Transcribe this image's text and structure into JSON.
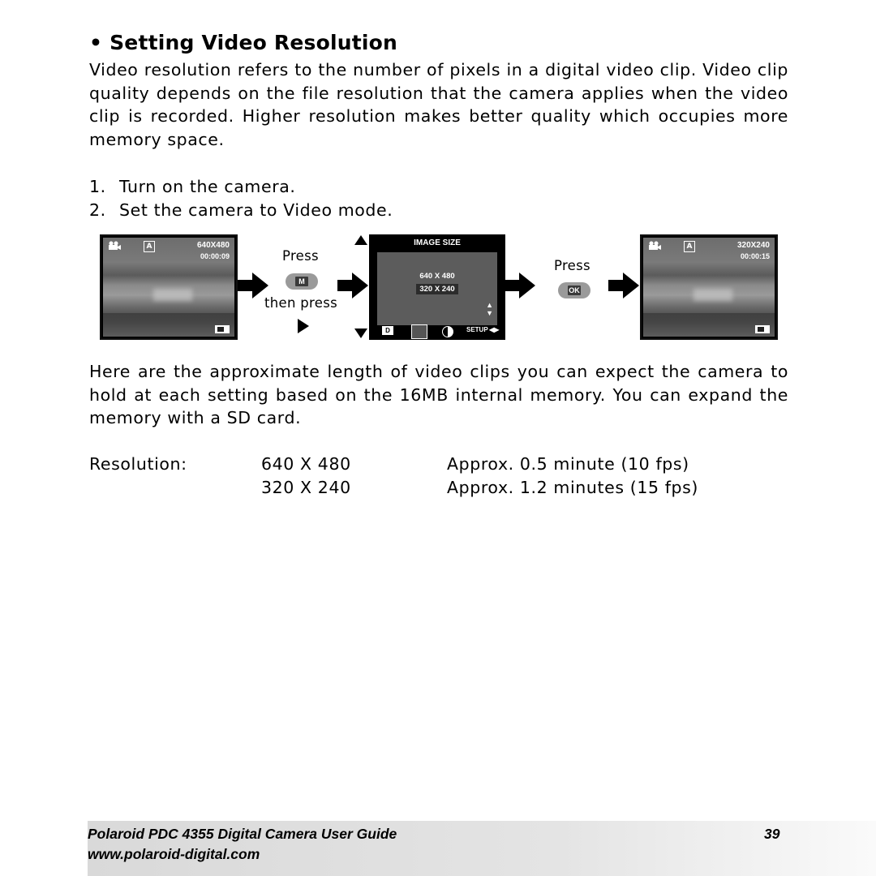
{
  "heading": "• Setting Video Resolution",
  "intro": "Video resolution refers to the number of pixels in a digital video clip. Video clip quality depends on the file resolution that the camera applies when the video clip is recorded. Higher resolution makes better quality which occupies more memory space.",
  "steps": [
    {
      "num": "1.",
      "text": "Turn on the camera."
    },
    {
      "num": "2.",
      "text": "Set the camera to Video mode."
    }
  ],
  "diagram": {
    "screen_before": {
      "resolution": "640X480",
      "time": "00:00:09",
      "icons": [
        "video-camera-icon",
        "flash-auto-icon",
        "battery-icon"
      ]
    },
    "press1": "Press",
    "button_m": "M",
    "then_press": "then press",
    "menu": {
      "title": "IMAGE SIZE",
      "options": [
        "640 X 480",
        "320 X 240"
      ],
      "selected": "320 X 240",
      "tabs": [
        "camera-icon",
        "image-size-icon",
        "contrast-icon",
        "SETUP"
      ]
    },
    "press2": "Press",
    "button_ok": "OK",
    "screen_after": {
      "resolution": "320X240",
      "time": "00:00:15",
      "icons": [
        "video-camera-icon",
        "flash-auto-icon",
        "battery-icon"
      ]
    }
  },
  "body2": "Here are the approximate length of video clips you can expect the camera to hold at each setting based on the 16MB internal memory. You can expand the memory with a SD card.",
  "table": {
    "label": "Resolution:",
    "rows": [
      {
        "res": "640 X 480",
        "desc": "Approx. 0.5 minute (10 fps)"
      },
      {
        "res": "320 X 240",
        "desc": "Approx. 1.2 minutes (15 fps)"
      }
    ]
  },
  "footer": {
    "title": "Polaroid PDC 4355 Digital Camera User Guide",
    "url": "www.polaroid-digital.com",
    "page": "39"
  }
}
